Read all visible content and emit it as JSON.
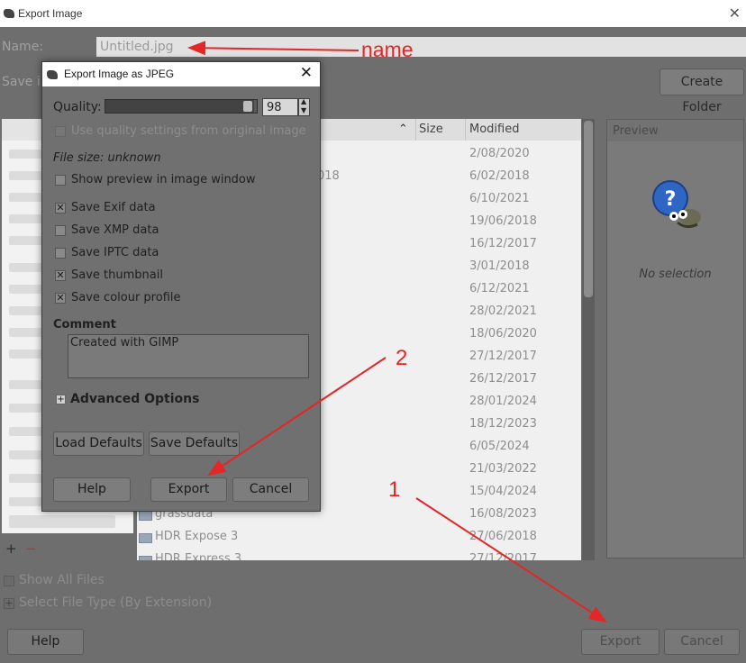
{
  "window": {
    "title": "Export Image"
  },
  "name_row": {
    "label": "Name:",
    "value": "Untitled.jpg"
  },
  "save_in": {
    "label": "Save i"
  },
  "create_folder_label": "Create Folder",
  "columns": {
    "name": "",
    "size": "Size",
    "modified": "Modified"
  },
  "files": [
    {
      "name": "",
      "modified": "2/08/2020"
    },
    {
      "name": "018",
      "modified": "6/02/2018"
    },
    {
      "name": "",
      "modified": "6/10/2021"
    },
    {
      "name": "",
      "modified": "19/06/2018"
    },
    {
      "name": "",
      "modified": "16/12/2017"
    },
    {
      "name": "",
      "modified": "3/01/2018"
    },
    {
      "name": "",
      "modified": "6/12/2021"
    },
    {
      "name": "",
      "modified": "28/02/2021"
    },
    {
      "name": "",
      "modified": "18/06/2020"
    },
    {
      "name": "",
      "modified": "27/12/2017"
    },
    {
      "name": "",
      "modified": "26/12/2017"
    },
    {
      "name": "",
      "modified": "28/01/2024"
    },
    {
      "name": "",
      "modified": "18/12/2023"
    },
    {
      "name": "",
      "modified": "6/05/2024"
    },
    {
      "name": "",
      "modified": "21/03/2022"
    },
    {
      "name": "",
      "modified": "15/04/2024"
    },
    {
      "name": "grassdata",
      "modified": "16/08/2023"
    },
    {
      "name": "HDR Expose 3",
      "modified": "27/06/2018"
    },
    {
      "name": "HDR Express 3",
      "modified": "27/12/2017"
    }
  ],
  "preview": {
    "label": "Preview",
    "no_selection": "No selection"
  },
  "places": {
    "add": "+",
    "remove": "−"
  },
  "bottom": {
    "show_all_files": "Show All Files",
    "select_file_type": "Select File Type (By Extension)",
    "help": "Help",
    "export": "Export",
    "cancel": "Cancel"
  },
  "jpeg_dialog": {
    "title": "Export Image as JPEG",
    "quality_label": "Quality:",
    "quality_value": "98",
    "quality_fraction": 0.98,
    "use_quality": "Use quality settings from original image",
    "file_size": "File size: unknown",
    "show_preview": "Show preview in image window",
    "save_exif": "Save Exif data",
    "save_xmp": "Save XMP data",
    "save_iptc": "Save IPTC data",
    "save_thumbnail": "Save thumbnail",
    "save_colour_profile": "Save colour profile",
    "comment_label": "Comment",
    "comment_value": "Created with GIMP",
    "advanced_options": "Advanced Options",
    "load_defaults": "Load Defaults",
    "save_defaults": "Save Defaults",
    "help": "Help",
    "export": "Export",
    "cancel": "Cancel"
  },
  "annotations": {
    "name": "name",
    "one": "1",
    "two": "2"
  },
  "colors": {
    "annotation_red": "#e32626"
  }
}
